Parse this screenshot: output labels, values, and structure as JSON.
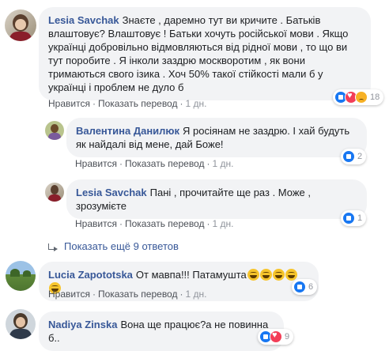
{
  "comments": [
    {
      "author": "Lesia Savchak",
      "text": "Знаєте , даремно тут ви кричите . Батьків влаштовує? Влаштовує ! Батьки хочуть російської мови . Якщо українці добровільно відмовляються від рідної мови , то що ви тут поробите . Я інколи заздрю москворотим , як вони тримаються свого ізика . Хоч 50% такої стійкості мали б у українці і проблем не дуло б",
      "like": "Нравится",
      "translate": "Показать перевод",
      "time": "1 дн.",
      "reactions": [
        "like-icon",
        "love-icon",
        "sad-icon"
      ],
      "reaction_count": "18"
    },
    {
      "author": "Валентина Данилюк",
      "text": "Я росіянам не заздрю. І хай будуть як найдалі від мене, дай Боже!",
      "like": "Нравится",
      "translate": "Показать перевод",
      "time": "1 дн.",
      "reactions": [
        "like-icon"
      ],
      "reaction_count": "2"
    },
    {
      "author": "Lesia Savchak",
      "text": "Пані , прочитайте ще раз . Може , зрозумієте",
      "like": "Нравится",
      "translate": "Показать перевод",
      "time": "1 дн.",
      "reactions": [
        "like-icon"
      ],
      "reaction_count": "1"
    },
    {
      "author": "Lucia Zapototska",
      "text": "От мавпа!!! Патамушта",
      "like": "Нравится",
      "translate": "Показать перевод",
      "time": "1 дн.",
      "reactions": [
        "like-icon"
      ],
      "reaction_count": "6"
    },
    {
      "author": "Nadiya Zinska",
      "text": "Вона ще працює?а не повинна б..",
      "reactions": [
        "like-icon",
        "love-icon"
      ],
      "reaction_count": "9"
    }
  ],
  "more_replies": "Показать ещё 9 ответов",
  "colors": {
    "link": "#385898",
    "bubble": "#f2f3f5",
    "like": "#1877f2"
  }
}
